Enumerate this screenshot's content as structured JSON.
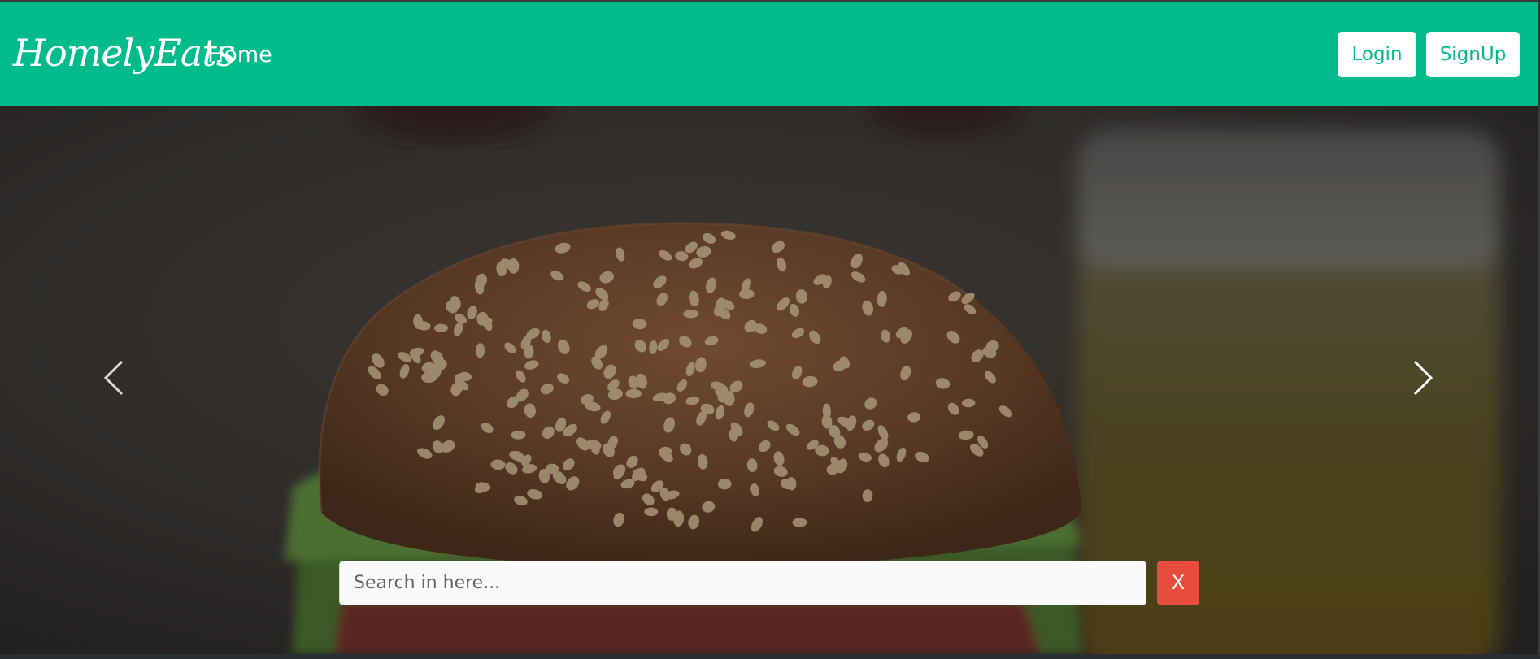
{
  "navbar": {
    "brand": "HomelyEats",
    "home_label": "Home",
    "login_label": "Login",
    "signup_label": "SignUp",
    "background": "#00bc8c",
    "button_text_color": "#00bc8c"
  },
  "carousel": {
    "prev_icon": "chevron-left-icon",
    "next_icon": "chevron-right-icon"
  },
  "search": {
    "placeholder": "Search in here...",
    "value": "",
    "clear_label": "X",
    "clear_color": "#e74c3c"
  }
}
